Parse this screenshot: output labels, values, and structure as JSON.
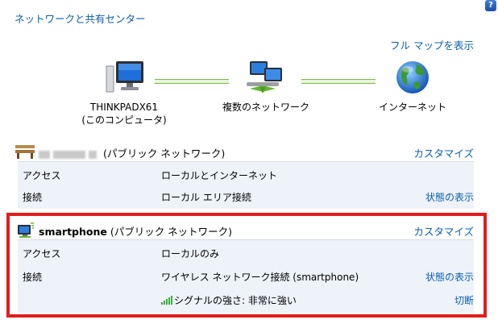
{
  "header": {
    "breadcrumb": "ネットワークと共有センター",
    "help": "?",
    "full_map": "フル マップを表示"
  },
  "map": {
    "computer": {
      "line1": "THINKPADX61",
      "line2": "(このコンピュータ)"
    },
    "network": {
      "label": "複数のネットワーク"
    },
    "internet": {
      "label": "インターネット"
    }
  },
  "net1": {
    "name_suffix": "(パブリック ネットワーク)",
    "customize": "カスタマイズ",
    "access_label": "アクセス",
    "access_value": "ローカルとインターネット",
    "connection_label": "接続",
    "connection_value": "ローカル エリア接続",
    "status_link": "状態の表示"
  },
  "net2": {
    "name": "smartphone",
    "name_suffix": " (パブリック ネットワーク)",
    "customize": "カスタマイズ",
    "access_label": "アクセス",
    "access_value": "ローカルのみ",
    "connection_label": "接続",
    "connection_value": "ワイヤレス ネットワーク接続 (smartphone)",
    "status_link": "状態の表示",
    "signal_text": "シグナルの強さ: 非常に強い",
    "disconnect": "切断"
  },
  "colors": {
    "link": "#0b5fb0",
    "highlight": "#e21d1d",
    "panel": "#eef2f9"
  }
}
